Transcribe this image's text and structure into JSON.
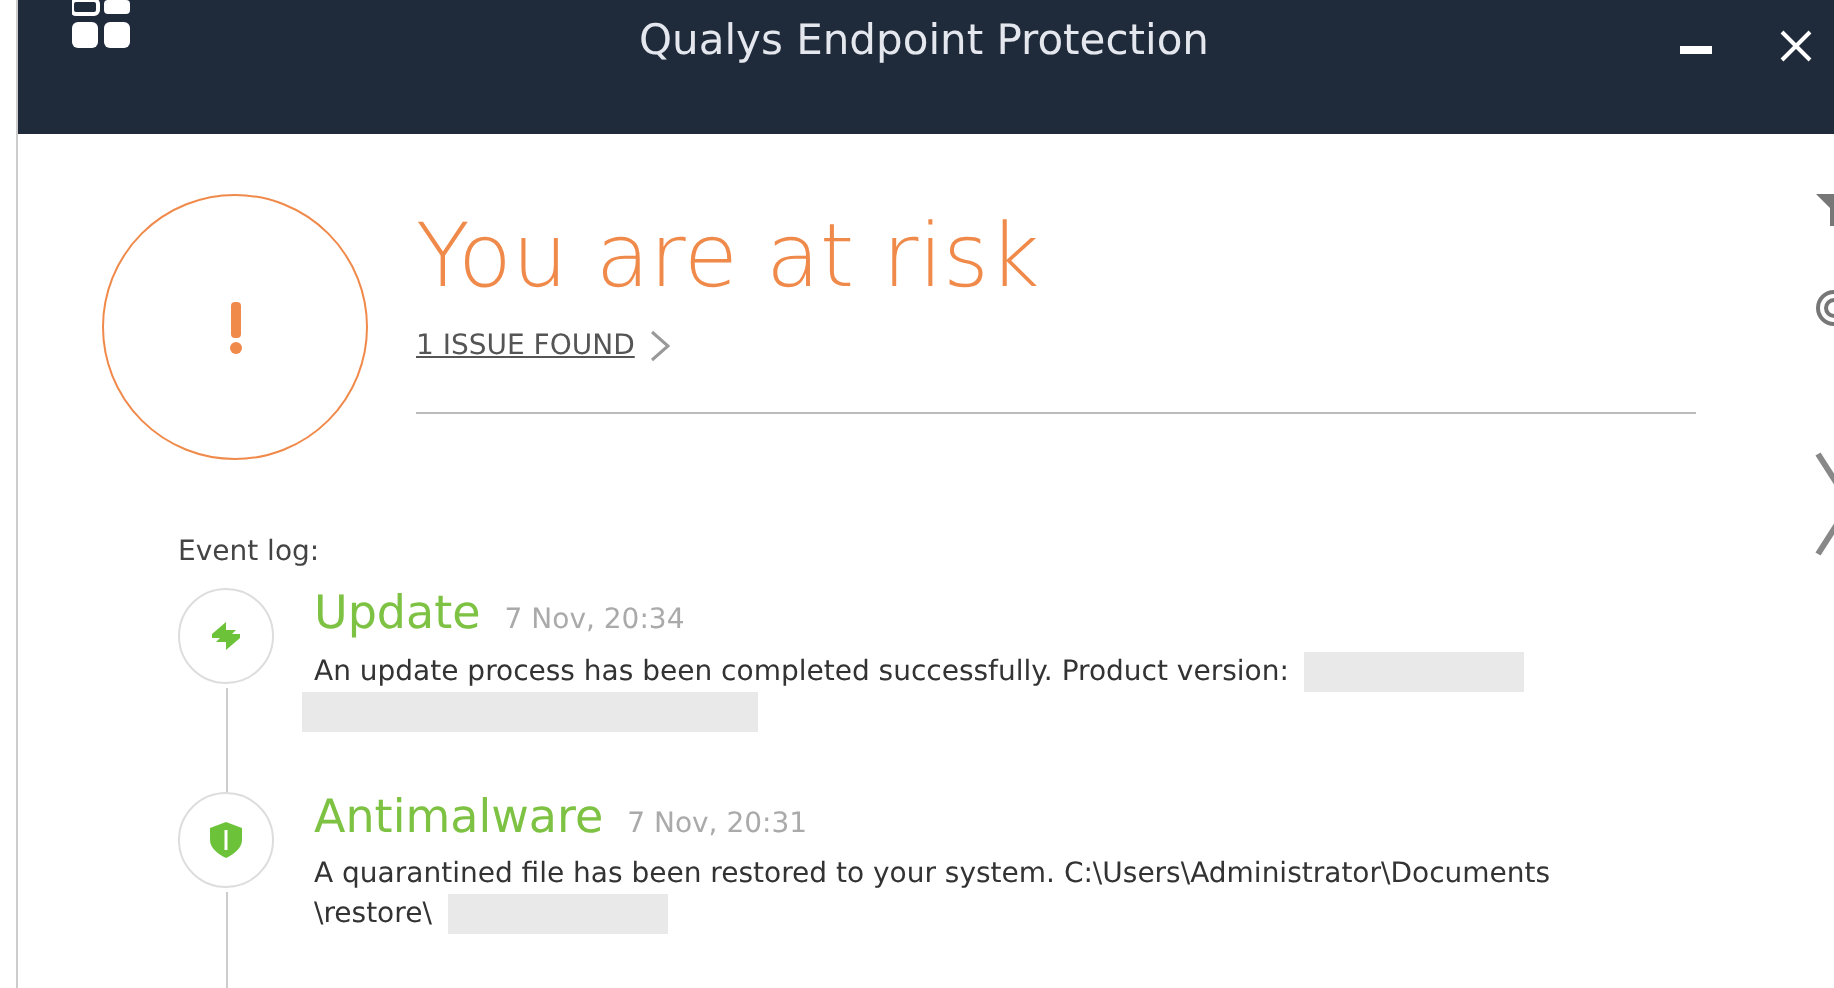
{
  "window": {
    "title": "Qualys Endpoint Protection",
    "controls": [
      {
        "kind": "minimize"
      },
      {
        "kind": "close"
      }
    ]
  },
  "status": {
    "kind": "risk",
    "title": "You are at risk",
    "issues_link": "1 ISSUE FOUND"
  },
  "side_tools": [
    {
      "kind": "filter"
    },
    {
      "kind": "scan"
    },
    {
      "kind": "next"
    }
  ],
  "event_log": {
    "label": "Event log:",
    "events": [
      {
        "kind": "update",
        "title": "Update",
        "time": "7 Nov, 20:34",
        "parts": [
          {
            "kind": "text",
            "text": "An update process has been completed successfully. Product version:"
          },
          {
            "kind": "blur"
          },
          {
            "kind": "blurline"
          }
        ]
      },
      {
        "kind": "antimalware",
        "title": "Antimalware",
        "time": "7 Nov, 20:31",
        "parts": [
          {
            "kind": "text",
            "text": "A quarantined file has been restored to your system. C:\\Users\\Administrator\\Documents"
          },
          {
            "kind": "text",
            "text": "\\restore\\"
          },
          {
            "kind": "blur"
          }
        ]
      }
    ]
  }
}
